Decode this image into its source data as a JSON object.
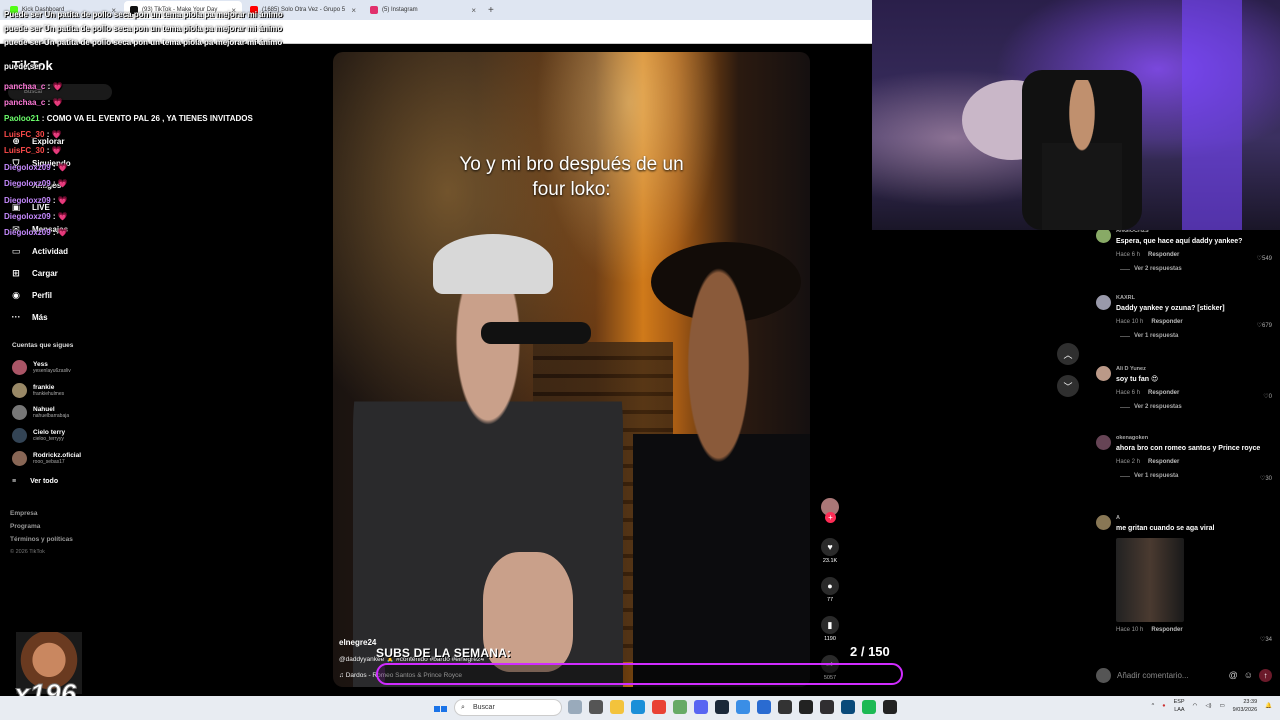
{
  "browser": {
    "tabs": [
      {
        "label": "Kick Dashboard",
        "color": "#53fc18",
        "active": false
      },
      {
        "label": "(93) TikTok - Make Your Day",
        "color": "#111111",
        "active": true
      },
      {
        "label": "(1685) Solo Otra Vez - Grupo 5",
        "color": "#ff0000",
        "active": false
      },
      {
        "label": "(5) Instagram",
        "color": "#e1306c",
        "active": false
      }
    ],
    "new_tab": "+"
  },
  "tiktok": {
    "logo": "TikTok",
    "search_placeholder": "Buscar",
    "nav": [
      {
        "label": "Explorar",
        "icon": "compass-icon"
      },
      {
        "label": "Siguiendo",
        "icon": "following-icon"
      },
      {
        "label": "Amigos",
        "icon": "friends-icon"
      },
      {
        "label": "LIVE",
        "icon": "live-icon"
      },
      {
        "label": "Mensajes",
        "icon": "message-icon"
      },
      {
        "label": "Actividad",
        "icon": "activity-icon"
      },
      {
        "label": "Cargar",
        "icon": "upload-icon"
      },
      {
        "label": "Perfil",
        "icon": "profile-icon"
      },
      {
        "label": "Más",
        "icon": "more-icon"
      }
    ],
    "following_title": "Cuentas que sigues",
    "following": [
      {
        "name": "Yess",
        "handle": "yesenlayu6zasliv"
      },
      {
        "name": "frankie",
        "handle": "frankiehulmes"
      },
      {
        "name": "Nahuel",
        "handle": "nahuelbarrabaja"
      },
      {
        "name": "Cielo terry",
        "handle": "cieloo_terryyy"
      },
      {
        "name": "Rodrickz.oficial",
        "handle": "rooo_sebas17"
      }
    ],
    "see_all": "Ver todo",
    "footer": [
      "Empresa",
      "Programa",
      "Términos y políticas"
    ],
    "copyright": "© 2026 TikTok"
  },
  "chat": {
    "top_lines": [
      "Puede ser Un patita de pollo seca pon un tema piola pa mejorar mi ánimo",
      "puede ser Un patita de pollo seca pon un tema piola pa mejorar mi ánimo",
      "puede ser Un patita de pollo seca pon un tema piola pa mejorar mi ánimo",
      "puede ser"
    ],
    "messages": [
      {
        "user": "panchaa_c",
        "text": "",
        "color": "pink"
      },
      {
        "user": "panchaa_c",
        "text": "",
        "color": "pink"
      },
      {
        "user": "Paoloo21",
        "text": "COMO VA EL EVENTO PAL 26 , YA TIENES INVITADOS",
        "color": "green"
      },
      {
        "user": "LuisFC_30",
        "text": "",
        "color": "red"
      },
      {
        "user": "LuisFC_30",
        "text": "",
        "color": "red"
      },
      {
        "user": "Diegoloxz09",
        "text": "",
        "color": "purple"
      },
      {
        "user": "Diegoloxz09",
        "text": "",
        "color": "purple"
      },
      {
        "user": "Diegoloxz09",
        "text": "",
        "color": "purple"
      },
      {
        "user": "Diegoloxz09",
        "text": "",
        "color": "purple"
      },
      {
        "user": "Diegoloxz09",
        "text": "",
        "color": "purple"
      }
    ]
  },
  "video": {
    "caption_line1": "Yo y mi bro después de un",
    "caption_line2": "four loko:",
    "author": "elnegre24",
    "description": "@daddyyankee 🙏 #contenido #bardo #elnegre24",
    "music": "Dardos - Romeo Santos & Prince Royce",
    "likes": "23.1K",
    "comments": "77",
    "saves": "1190",
    "shares": "5057"
  },
  "comments": [
    {
      "user": "ANGIOCH2S",
      "text": "Espera, que hace aquí daddy yankee?",
      "time": "Hace 6 h",
      "likes": "549",
      "replies": "Ver 2 respuestas"
    },
    {
      "user": "KAXRL",
      "text": "Daddy yankee y ozuna? [sticker]",
      "time": "Hace 10 h",
      "likes": "679",
      "replies": "Ver 1 respuesta"
    },
    {
      "user": "Ali D Yunez",
      "text": "soy tu fan 😍",
      "time": "Hace 6 h",
      "likes": "0",
      "replies": "Ver 2 respuestas"
    },
    {
      "user": "okenagoken",
      "text": "ahora bro con romeo santos y Prince royce",
      "time": "Hace 2 h",
      "likes": "30",
      "replies": "Ver 1 respuesta"
    },
    {
      "user": "A",
      "text": "me gritan cuando se aga viral",
      "time": "Hace 10 h",
      "likes": "34",
      "replies": ""
    }
  ],
  "reply_label": "Responder",
  "comment_placeholder": "Añadir comentario...",
  "overlay": {
    "subs_label": "SUBS DE LA SEMANA:",
    "subs_count": "2 / 150",
    "subs_progress": 0.013,
    "combo": "x196"
  },
  "taskbar": {
    "weather": "",
    "search_placeholder": "Buscar",
    "lang_top": "ESP",
    "lang_bottom": "LAA",
    "time": "23:39",
    "date": "9/03/2026"
  },
  "colors": {
    "accent": "#fe2c55",
    "subs_bar": "#d02cff"
  }
}
